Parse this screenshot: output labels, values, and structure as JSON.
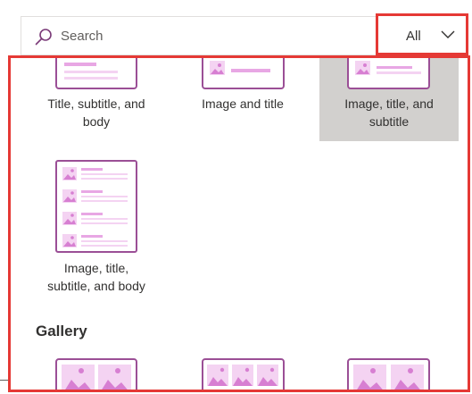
{
  "search": {
    "placeholder": "Search"
  },
  "filter": {
    "selected": "All"
  },
  "layouts": [
    {
      "label_line1": "Title, subtitle, and",
      "label_line2": "body"
    },
    {
      "label_line1": "Image and title",
      "label_line2": ""
    },
    {
      "label_line1": "Image, title, and",
      "label_line2": "subtitle"
    },
    {
      "label_line1": "Image, title,",
      "label_line2": "subtitle, and body"
    }
  ],
  "sections": {
    "gallery": "Gallery"
  },
  "colors": {
    "accent": "#9b4f96",
    "pink": "#e8a7e4",
    "pink_light": "#f4d3f2",
    "highlight": "#e53935",
    "selected": "#d2d0ce"
  }
}
